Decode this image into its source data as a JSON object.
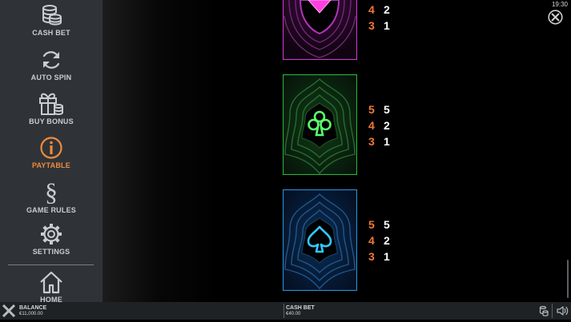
{
  "clock": "19:30",
  "sidebar": {
    "items": [
      {
        "label": "CASH BET",
        "icon": "coin-stack-icon"
      },
      {
        "label": "AUTO SPIN",
        "icon": "refresh-icon"
      },
      {
        "label": "BUY BONUS",
        "icon": "gift-icon"
      },
      {
        "label": "PAYTABLE",
        "icon": "info-icon",
        "active": true
      },
      {
        "label": "GAME RULES",
        "icon": "section-icon"
      },
      {
        "label": "SETTINGS",
        "icon": "gear-icon"
      },
      {
        "label": "HOME",
        "icon": "home-icon"
      }
    ]
  },
  "paytable": [
    {
      "symbol": "diamond",
      "color": "#e14ee6",
      "rows": [
        {
          "count": "4",
          "value": "2"
        },
        {
          "count": "3",
          "value": "1"
        }
      ]
    },
    {
      "symbol": "club",
      "color": "#35e04a",
      "rows": [
        {
          "count": "5",
          "value": "5"
        },
        {
          "count": "4",
          "value": "2"
        },
        {
          "count": "3",
          "value": "1"
        }
      ]
    },
    {
      "symbol": "spade",
      "color": "#20b6f2",
      "rows": [
        {
          "count": "5",
          "value": "5"
        },
        {
          "count": "4",
          "value": "2"
        },
        {
          "count": "3",
          "value": "1"
        }
      ]
    }
  ],
  "bottom_bar": {
    "balance_label": "BALANCE",
    "balance_value": "€11,000.00",
    "cash_bet_label": "CASH BET",
    "cash_bet_value": "€40.00"
  },
  "colors": {
    "accent": "#f07a34",
    "sidebar": "#2f3337",
    "bottom_bar": "#1f2225"
  }
}
